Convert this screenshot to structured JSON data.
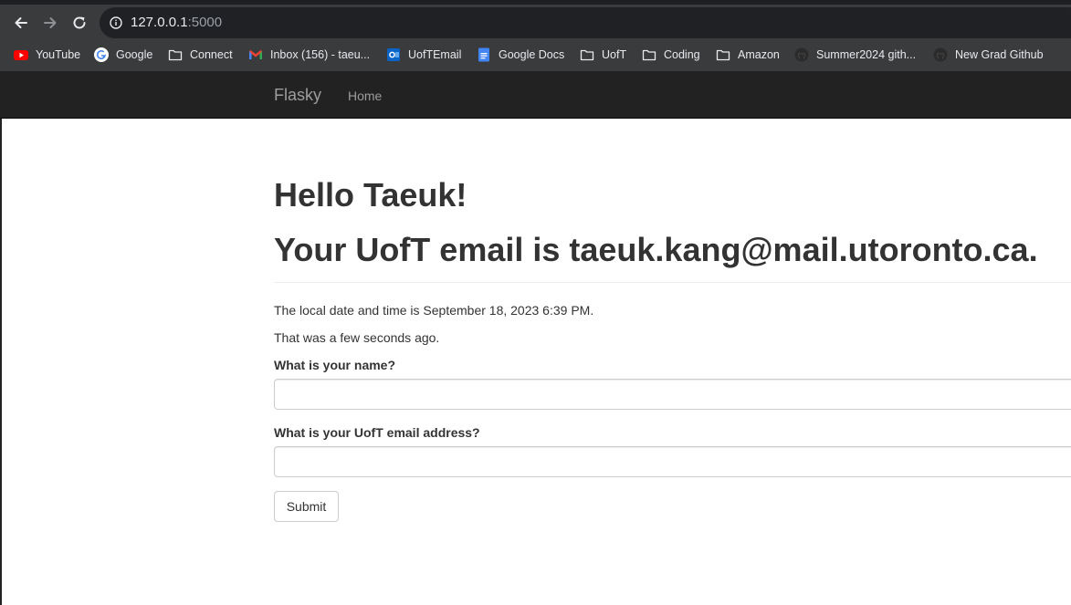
{
  "browser": {
    "url_host": "127.0.0.1",
    "url_port": ":5000",
    "icons": {
      "back": "arrow-left-icon",
      "forward": "arrow-right-icon",
      "reload": "reload-icon",
      "site_info": "info-icon"
    },
    "bookmarks": [
      {
        "label": "YouTube",
        "icon": "youtube-icon"
      },
      {
        "label": "Google",
        "icon": "google-icon"
      },
      {
        "label": "Connect",
        "icon": "folder-icon"
      },
      {
        "label": "Inbox (156) - taeu...",
        "icon": "gmail-icon"
      },
      {
        "label": "UofTEmail",
        "icon": "outlook-icon"
      },
      {
        "label": "Google Docs",
        "icon": "google-docs-icon"
      },
      {
        "label": "UofT",
        "icon": "folder-icon"
      },
      {
        "label": "Coding",
        "icon": "folder-icon"
      },
      {
        "label": "Amazon",
        "icon": "folder-icon"
      },
      {
        "label": "Summer2024 gith...",
        "icon": "github-icon"
      },
      {
        "label": "New Grad Github",
        "icon": "github-icon"
      }
    ]
  },
  "navbar": {
    "brand": "Flasky",
    "home": "Home"
  },
  "page": {
    "greeting": "Hello Taeuk!",
    "email_line": "Your UofT email is taeuk.kang@mail.utoronto.ca.",
    "date_line": "The local date and time is September 18, 2023 6:39 PM.",
    "ago_line": "That was a few seconds ago."
  },
  "form": {
    "name_label": "What is your name?",
    "name_value": "",
    "email_label": "What is your UofT email address?",
    "email_value": "",
    "submit_label": "Submit"
  },
  "colors": {
    "navbar_bg": "#222222",
    "navbar_text": "#9d9d9d",
    "body_text": "#333333",
    "chrome_bg": "#3a3b3d"
  }
}
